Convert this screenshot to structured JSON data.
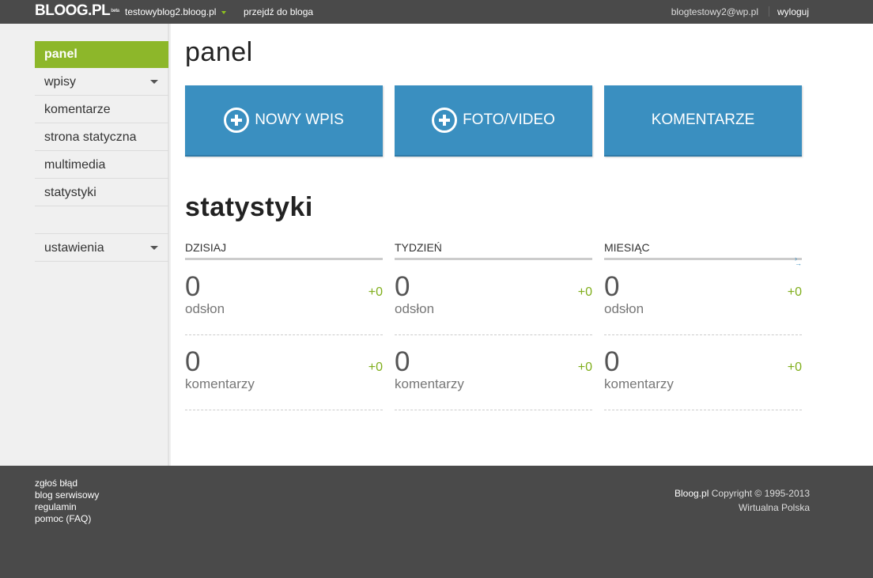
{
  "topbar": {
    "logo": "BLOOG.PL",
    "logo_sup": "beta",
    "blog_name": "testowyblog2.bloog.pl",
    "goto_blog": "przejdź do bloga",
    "user_email": "blogtestowy2@wp.pl",
    "logout": "wyloguj"
  },
  "sidebar": {
    "items": [
      {
        "label": "panel"
      },
      {
        "label": "wpisy"
      },
      {
        "label": "komentarze"
      },
      {
        "label": "strona statyczna"
      },
      {
        "label": "multimedia"
      },
      {
        "label": "statystyki"
      }
    ],
    "settings": "ustawienia"
  },
  "main": {
    "title": "panel",
    "tiles": {
      "new_post": "NOWY WPIS",
      "photo_video": "FOTO/VIDEO",
      "comments": "KOMENTARZE"
    },
    "stats_title": "statystyki",
    "stats": [
      {
        "period": "DZISIAJ",
        "views": "0",
        "views_delta": "+0",
        "views_label": "odsłon",
        "comments": "0",
        "comments_delta": "+0",
        "comments_label": "komentarzy"
      },
      {
        "period": "TYDZIEŃ",
        "views": "0",
        "views_delta": "+0",
        "views_label": "odsłon",
        "comments": "0",
        "comments_delta": "+0",
        "comments_label": "komentarzy"
      },
      {
        "period": "MIESIĄC",
        "views": "0",
        "views_delta": "+0",
        "views_label": "odsłon",
        "comments": "0",
        "comments_delta": "+0",
        "comments_label": "komentarzy"
      }
    ]
  },
  "footer": {
    "links": [
      "zgłoś błąd",
      "blog serwisowy",
      "regulamin",
      "pomoc (FAQ)"
    ],
    "brand": "Bloog.pl",
    "copyright": "Copyright © 1995-2013",
    "company": "Wirtualna Polska"
  },
  "colors": {
    "topbar": "#4a4a4a",
    "accent_green": "#8db72a",
    "tile_blue": "#3a8fc0",
    "delta_green": "#7fae1b"
  }
}
